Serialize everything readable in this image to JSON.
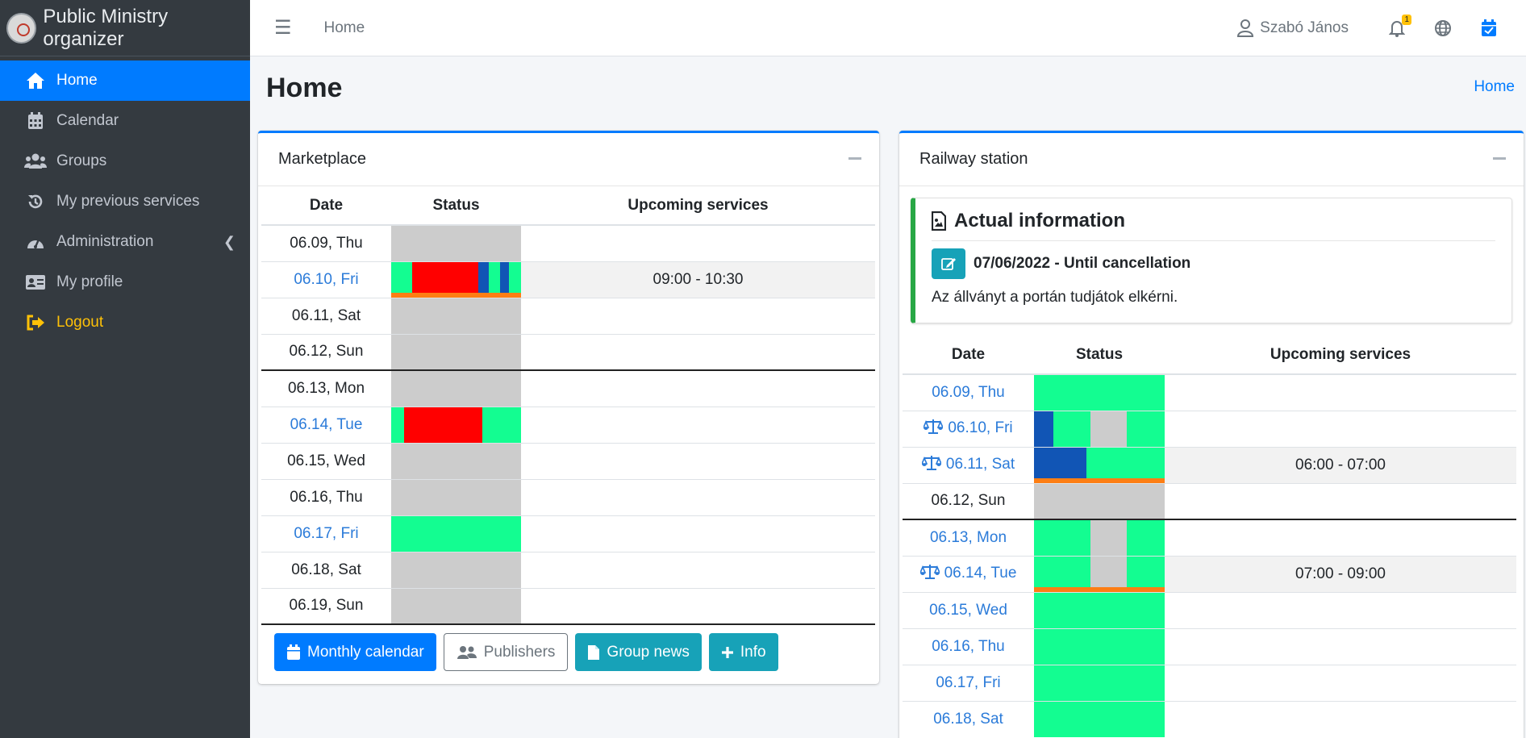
{
  "app": {
    "title": "Public Ministry organizer"
  },
  "sidebar": {
    "items": [
      {
        "label": "Home",
        "icon": "home-icon",
        "active": true
      },
      {
        "label": "Calendar",
        "icon": "calendar-icon"
      },
      {
        "label": "Groups",
        "icon": "users-icon"
      },
      {
        "label": "My previous services",
        "icon": "history-icon"
      },
      {
        "label": "Administration",
        "icon": "gauge-icon"
      },
      {
        "label": "My profile",
        "icon": "id-card-icon"
      },
      {
        "label": "Logout",
        "icon": "sign-out-icon"
      }
    ]
  },
  "topbar": {
    "home": "Home",
    "user": "Szabó János",
    "notifications": "1"
  },
  "page": {
    "title": "Home",
    "breadcrumb": "Home"
  },
  "colors": {
    "green": "#13fd91",
    "gray": "#cccccc",
    "red": "#ff0000",
    "blue": "#1155b5",
    "orange": "#fd7e14",
    "accent": "#007bff"
  },
  "marketplace": {
    "title": "Marketplace",
    "headers": {
      "date": "Date",
      "status": "Status",
      "services": "Upcoming services"
    },
    "buttons": {
      "monthly": "Monthly calendar",
      "publishers": "Publishers",
      "news": "Group news",
      "info": "Info"
    },
    "rows": [
      {
        "date": "06.09, Thu",
        "link": false,
        "segments": [
          [
            "gray",
            1
          ]
        ],
        "service": ""
      },
      {
        "date": "06.10, Fri",
        "link": true,
        "segments": [
          [
            "green",
            0.16
          ],
          [
            "red",
            0.51
          ],
          [
            "blue",
            0.08
          ],
          [
            "green",
            0.09
          ],
          [
            "blue",
            0.07
          ],
          [
            "green",
            0.09
          ]
        ],
        "orange": true,
        "service": "09:00 - 10:30"
      },
      {
        "date": "06.11, Sat",
        "link": false,
        "segments": [
          [
            "gray",
            1
          ]
        ],
        "service": ""
      },
      {
        "date": "06.12, Sun",
        "link": false,
        "segments": [
          [
            "gray",
            1
          ]
        ],
        "service": ""
      },
      {
        "date": "06.13, Mon",
        "link": false,
        "week": true,
        "segments": [
          [
            "gray",
            1
          ]
        ],
        "service": ""
      },
      {
        "date": "06.14, Tue",
        "link": true,
        "segments": [
          [
            "green",
            0.1
          ],
          [
            "red",
            0.6
          ],
          [
            "green",
            0.3
          ]
        ],
        "service": ""
      },
      {
        "date": "06.15, Wed",
        "link": false,
        "segments": [
          [
            "gray",
            1
          ]
        ],
        "service": ""
      },
      {
        "date": "06.16, Thu",
        "link": false,
        "segments": [
          [
            "gray",
            1
          ]
        ],
        "service": ""
      },
      {
        "date": "06.17, Fri",
        "link": true,
        "segments": [
          [
            "green",
            1
          ]
        ],
        "service": ""
      },
      {
        "date": "06.18, Sat",
        "link": false,
        "segments": [
          [
            "gray",
            1
          ]
        ],
        "service": ""
      },
      {
        "date": "06.19, Sun",
        "link": false,
        "segments": [
          [
            "gray",
            1
          ]
        ],
        "service": ""
      }
    ]
  },
  "railway": {
    "title": "Railway station",
    "info": {
      "heading": "Actual information",
      "period": "07/06/2022 - Until cancellation",
      "message": "Az állványt a portán tudjátok elkérni."
    },
    "headers": {
      "date": "Date",
      "status": "Status",
      "services": "Upcoming services"
    },
    "rows": [
      {
        "date": "06.09, Thu",
        "link": true,
        "scale": false,
        "segments": [
          [
            "green",
            1
          ]
        ],
        "service": ""
      },
      {
        "date": "06.10, Fri",
        "link": true,
        "scale": true,
        "segments": [
          [
            "blue",
            0.15
          ],
          [
            "green",
            0.28
          ],
          [
            "gray",
            0.28
          ],
          [
            "green",
            0.29
          ]
        ],
        "service": ""
      },
      {
        "date": "06.11, Sat",
        "link": true,
        "scale": true,
        "segments": [
          [
            "blue",
            0.4
          ],
          [
            "green",
            0.6
          ]
        ],
        "orange": true,
        "service": "06:00 - 07:00"
      },
      {
        "date": "06.12, Sun",
        "link": false,
        "scale": false,
        "segments": [
          [
            "gray",
            1
          ]
        ],
        "service": ""
      },
      {
        "date": "06.13, Mon",
        "link": true,
        "scale": false,
        "week": true,
        "segments": [
          [
            "green",
            0.43
          ],
          [
            "gray",
            0.28
          ],
          [
            "green",
            0.29
          ]
        ],
        "service": ""
      },
      {
        "date": "06.14, Tue",
        "link": true,
        "scale": true,
        "segments": [
          [
            "green",
            0.43
          ],
          [
            "gray",
            0.28
          ],
          [
            "green",
            0.29
          ]
        ],
        "orange": true,
        "service": "07:00 - 09:00"
      },
      {
        "date": "06.15, Wed",
        "link": true,
        "scale": false,
        "segments": [
          [
            "green",
            1
          ]
        ],
        "service": ""
      },
      {
        "date": "06.16, Thu",
        "link": true,
        "scale": false,
        "segments": [
          [
            "green",
            1
          ]
        ],
        "service": ""
      },
      {
        "date": "06.17, Fri",
        "link": true,
        "scale": false,
        "segments": [
          [
            "green",
            1
          ]
        ],
        "service": ""
      },
      {
        "date": "06.18, Sat",
        "link": true,
        "scale": false,
        "segments": [
          [
            "green",
            1
          ]
        ],
        "service": ""
      }
    ]
  }
}
